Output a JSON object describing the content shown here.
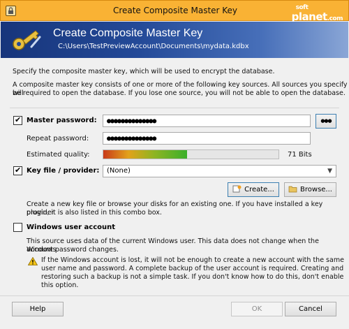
{
  "window": {
    "title": "Create Composite Master Key"
  },
  "watermark": {
    "line1": "soft",
    "line2": "planet",
    "suffix": ".com"
  },
  "banner": {
    "title": "Create Composite Master Key",
    "path": "C:\\Users\\TestPreviewAccount\\Documents\\mydata.kdbx"
  },
  "intro": {
    "line1": "Specify the composite master key, which will be used to encrypt the database.",
    "line2a": "A composite master key consists of one or more of the following key sources. All sources you specify will",
    "line2b": "be required to open the database.  If you lose one source, you will not be able to open the database."
  },
  "master_password": {
    "label": "Master password:",
    "checked": true,
    "value": "●●●●●●●●●●●●●●",
    "reveal_label": "●●●"
  },
  "repeat_password": {
    "label": "Repeat password:",
    "value": "●●●●●●●●●●●●●●"
  },
  "quality": {
    "label": "Estimated quality:",
    "fraction": 0.48,
    "bits_text": "71 Bits"
  },
  "key_file": {
    "label": "Key file / provider:",
    "checked": true,
    "selected": "(None)",
    "create_label": "Create...",
    "browse_label": "Browse...",
    "help1": "Create a new key file or browse your disks for an existing one. If you have installed a key provider",
    "help2": "plugin, it is also listed in this combo box."
  },
  "windows_account": {
    "label": "Windows user account",
    "checked": false,
    "desc1": "This source uses data of the current Windows user. This data does not change when the Windows",
    "desc2": "account password changes.",
    "warn1": "If the Windows account is lost, it will not be enough to create a new account with the same",
    "warn2": "user name and password. A complete backup of the user account is required. Creating and",
    "warn3": "restoring such a backup is not a simple task. If you don't know how to do this, don't enable",
    "warn4": "this option."
  },
  "buttons": {
    "help": "Help",
    "ok": "OK",
    "cancel": "Cancel"
  },
  "icons": {
    "app": "keepass-lock-icon",
    "banner": "key-icon",
    "create": "new-file-icon",
    "browse": "folder-icon",
    "warning": "warning-icon"
  },
  "colors": {
    "titlebar": "#f9b234",
    "banner": "#244a98"
  }
}
